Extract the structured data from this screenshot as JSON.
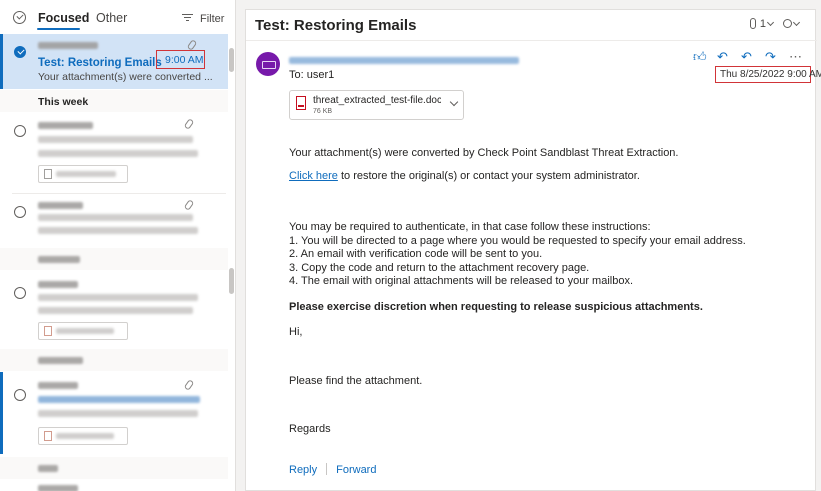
{
  "colors": {
    "accent": "#0f6cbd",
    "highlight": "#d13438",
    "selected_bg": "#d2e3f6",
    "avatar": "#7719aa"
  },
  "list": {
    "tabs": {
      "focused": "Focused",
      "other": "Other"
    },
    "filter_label": "Filter",
    "selected_message": {
      "subject": "Test: Restoring Emails",
      "time": "9:00 AM",
      "preview": "Your attachment(s) were converted ..."
    },
    "groups": {
      "this_week": "This week"
    }
  },
  "pane": {
    "title": "Test: Restoring Emails",
    "attachment_count": "1",
    "to_label": "To:",
    "to_value": "user1",
    "date": "Thu 8/25/2022 9:00 AM",
    "attachment": {
      "name": "threat_extracted_test-file.doc...",
      "size": "76 KB"
    },
    "body": {
      "line1": "Your attachment(s) were converted by Check Point Sandblast Threat Extraction.",
      "link_text": "Click here",
      "line2_rest": " to restore the original(s) or contact your system administrator.",
      "line3": "You may be required to authenticate, in that case follow these instructions:",
      "step1": "1. You will be directed to a page where you would be requested to specify your email address.",
      "step2": "2. An email with verification code will be sent to you.",
      "step3": "3. Copy the code and return to the attachment recovery page.",
      "step4": "4. The email with original attachments will be released to your mailbox.",
      "bold": "Please exercise discretion when requesting to release suspicious attachments.",
      "hi": "Hi,",
      "find": "Please find the attachment.",
      "regards": "Regards"
    },
    "reply_label": "Reply",
    "forward_label": "Forward"
  }
}
